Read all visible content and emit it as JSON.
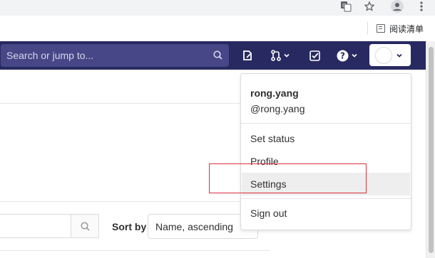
{
  "browser": {
    "icons": [
      "translate-icon",
      "star-icon",
      "profile-icon",
      "menu-icon"
    ],
    "reading_list_label": "阅读清单"
  },
  "navbar": {
    "search_placeholder": "Search or jump to...",
    "icons": [
      "search-icon",
      "todo-document-icon",
      "merge-request-icon",
      "issues-check-icon",
      "help-icon",
      "chevron-down-icon"
    ],
    "background": "#292961",
    "search_background": "#474787"
  },
  "user_dropdown": {
    "username": "rong.yang",
    "handle": "@rong.yang",
    "items": [
      {
        "label": "Set status"
      },
      {
        "label": "Profile"
      },
      {
        "label": "Settings",
        "highlighted": true
      },
      {
        "label": "Sign out"
      }
    ]
  },
  "page": {
    "sort_label": "Sort by",
    "sort_value": "Name, ascending"
  },
  "annotation": {
    "color": "#d9303c",
    "target": "Settings"
  }
}
